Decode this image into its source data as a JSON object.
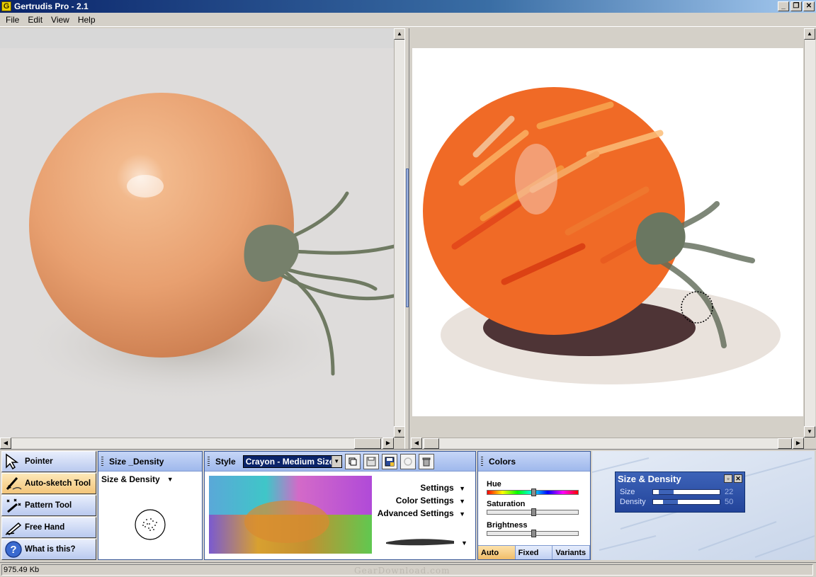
{
  "window": {
    "title": "Gertrudis Pro - 2.1",
    "app_icon_letter": "G",
    "minimize": "_",
    "maximize": "❐",
    "close": "✕"
  },
  "menu": [
    "File",
    "Edit",
    "View",
    "Help"
  ],
  "tools": [
    {
      "label": "Pointer",
      "icon": "pointer-arrow-icon",
      "active": false
    },
    {
      "label": "Auto-sketch Tool",
      "icon": "auto-sketch-icon",
      "active": true
    },
    {
      "label": "Pattern Tool",
      "icon": "pattern-tool-icon",
      "active": false
    },
    {
      "label": "Free Hand",
      "icon": "pen-icon",
      "active": false
    },
    {
      "label": "What is this?",
      "icon": "help-icon",
      "active": false
    }
  ],
  "size_panel": {
    "header": "Size _Density",
    "dropdown_label": "Size & Density",
    "dropdown_arrow": "▼"
  },
  "style_panel": {
    "header": "Style",
    "selected": "Crayon - Medium Size",
    "settings": "Settings",
    "color_settings": "Color Settings",
    "advanced_settings": "Advanced Settings",
    "arrow": "▼",
    "stroke_arrow": "▼"
  },
  "colors_panel": {
    "header": "Colors",
    "hue_label": "Hue",
    "saturation_label": "Saturation",
    "brightness_label": "Brightness",
    "hue_value": 0.5,
    "saturation_value": 0.5,
    "brightness_value": 0.5,
    "tabs": [
      "Auto",
      "Fixed",
      "Variants"
    ],
    "active_tab": 0
  },
  "floating_window": {
    "title": "Size & Density",
    "size_label": "Size",
    "size_value": "22",
    "density_label": "Density",
    "density_value": "50"
  },
  "status": {
    "file_size": "975.49 Kb",
    "watermark": "GearDownload.com"
  }
}
